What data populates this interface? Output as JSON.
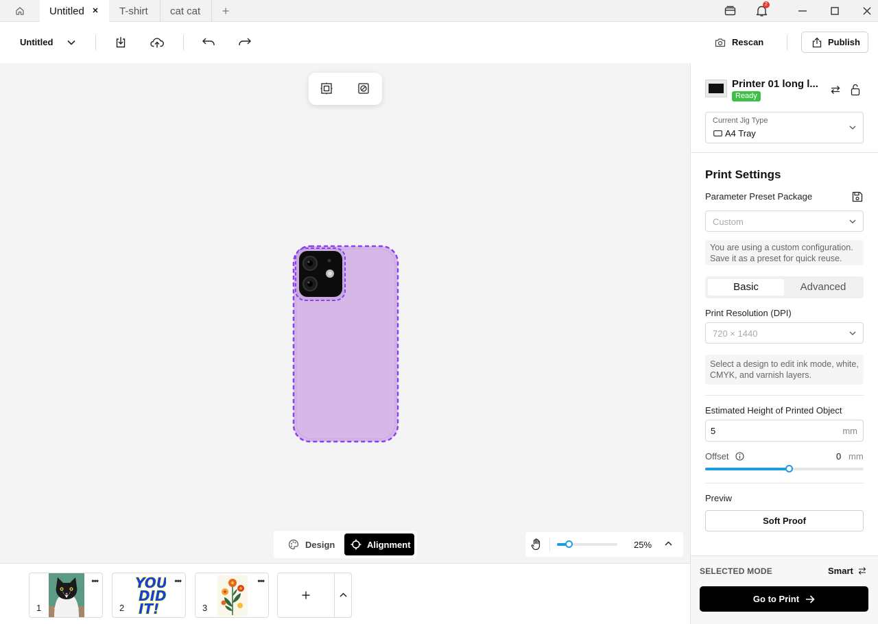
{
  "tabs": {
    "items": [
      "Untitled",
      "T-shirt",
      "cat cat"
    ],
    "notification_count": "2"
  },
  "toolbar": {
    "project_name": "Untitled",
    "rescan_label": "Rescan",
    "publish_label": "Publish"
  },
  "printer": {
    "name": "Printer 01 long l...",
    "status": "Ready",
    "jig_label": "Current Jig Type",
    "jig_value": "A4 Tray"
  },
  "print_settings": {
    "title": "Print Settings",
    "preset_label": "Parameter Preset Package",
    "preset_placeholder": "Custom",
    "preset_note": "You are using a custom configuration. Save it as a preset for quick reuse.",
    "tabs": [
      "Basic",
      "Advanced"
    ],
    "resolution_label": "Print Resolution (DPI)",
    "resolution_placeholder": "720 × 1440",
    "ink_note": "Select a design to edit ink mode, white, CMYK, and varnish layers.",
    "height_label": "Estimated Height of Printed Object",
    "height_value": "5",
    "height_unit": "mm",
    "offset_label": "Offset",
    "offset_value": "0",
    "offset_unit": "mm",
    "offset_slider_fraction": 0.53,
    "preview_label": "Previw",
    "soft_proof_label": "Soft Proof"
  },
  "footer": {
    "selected_mode_label": "SELECTED MODE",
    "selected_mode_value": "Smart",
    "go_to_print_label": "Go to Print"
  },
  "mode_switch": {
    "design_label": "Design",
    "alignment_label": "Alignment"
  },
  "zoom": {
    "value": "25%",
    "slider_fraction": 0.2
  },
  "designs": [
    {
      "number": "1",
      "name": "cat photo"
    },
    {
      "number": "2",
      "name": "YOU DID IT!",
      "text": "YOU DID IT!"
    },
    {
      "number": "3",
      "name": "flower illustration"
    }
  ],
  "colors": {
    "accent": "#1f9be0",
    "ready": "#3fbf4a",
    "phone_case": "#d5b7e8",
    "selection": "#8a3ff0",
    "notification": "#e53935"
  }
}
